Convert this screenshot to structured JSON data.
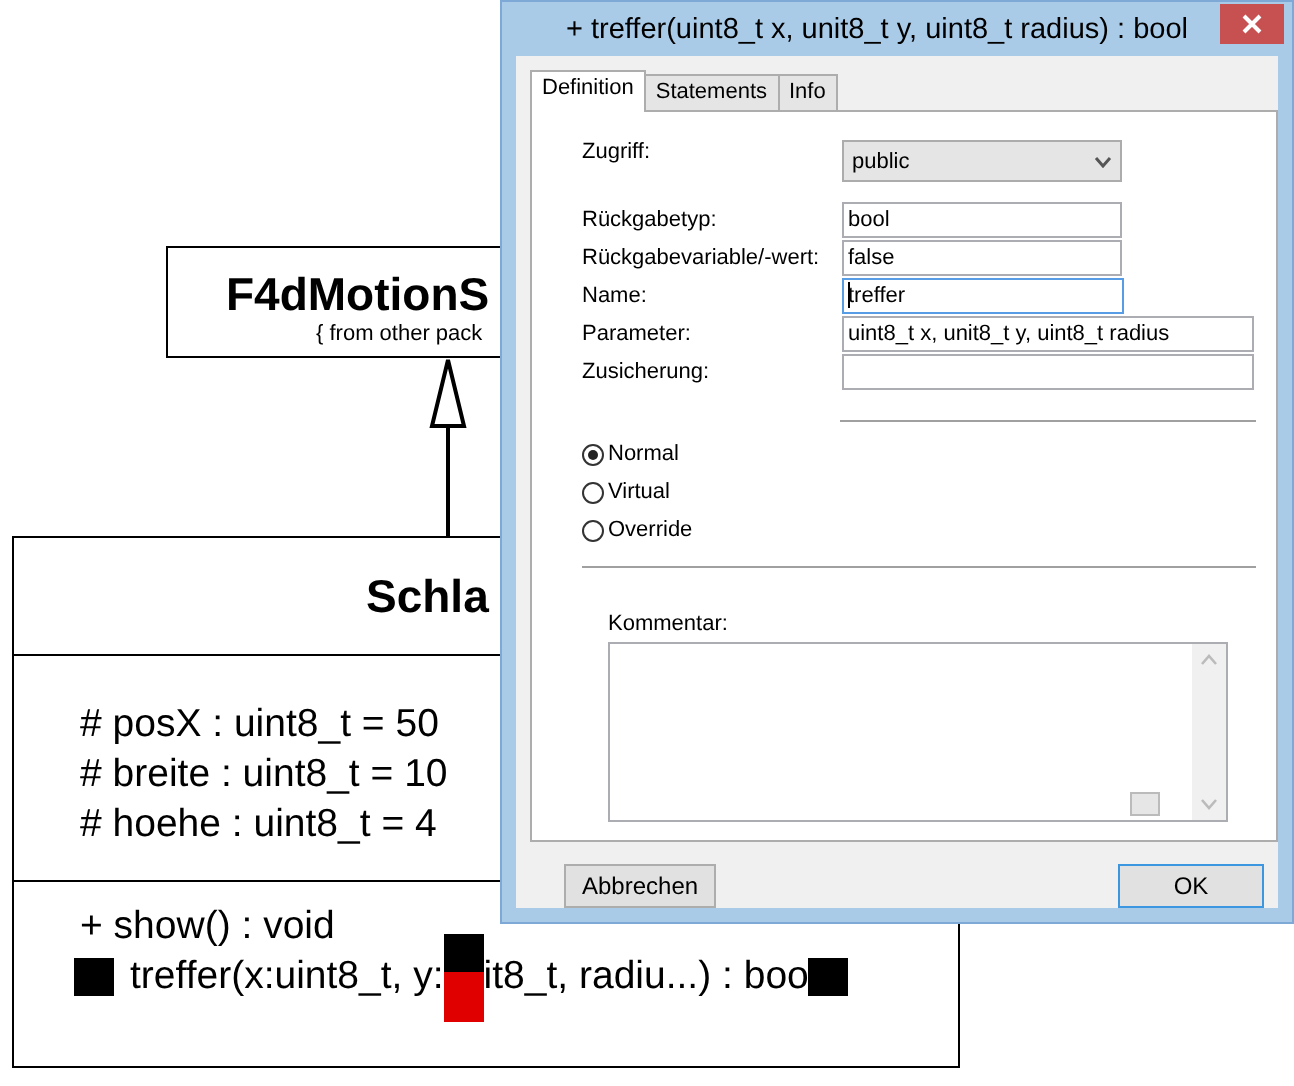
{
  "diagram": {
    "base_class": {
      "name": "F4dMotionS",
      "note": "{ from other pack"
    },
    "class": {
      "name": "Schla",
      "attributes": [
        "# posX : uint8_t = 50",
        "# breite : uint8_t = 10",
        "# hoehe : uint8_t = 4"
      ],
      "methods": [
        {
          "parts": [
            "+ show() : void"
          ],
          "selected": false
        },
        {
          "parts": [
            "treffer(x:uint8_t, y:",
            "it8_t, radiu...) : boo"
          ],
          "selected": true
        }
      ]
    }
  },
  "dialog": {
    "title": "+ treffer(uint8_t x, unit8_t y, uint8_t radius) : bool",
    "tabs": [
      {
        "label": "Definition",
        "selected": true
      },
      {
        "label": "Statements",
        "selected": false
      },
      {
        "label": "Info",
        "selected": false
      }
    ],
    "fields": [
      {
        "kind": "select",
        "label": "Zugriff:",
        "value": "public"
      },
      {
        "kind": "text",
        "label": "Rückgabetyp:",
        "value": "bool"
      },
      {
        "kind": "text",
        "label": "Rückgabevariable/-wert:",
        "value": "false"
      },
      {
        "kind": "text",
        "label": "Name:",
        "value": "treffer",
        "focused": true
      },
      {
        "kind": "text",
        "label": "Parameter:",
        "value": "uint8_t x, unit8_t y, uint8_t radius"
      },
      {
        "kind": "text",
        "label": "Zusicherung:"
      }
    ],
    "options": [
      {
        "label": "Normal",
        "selected": true
      },
      {
        "label": "Virtual",
        "selected": false
      },
      {
        "label": "Override",
        "selected": false
      }
    ],
    "comment": {
      "label": "Kommentar:"
    },
    "buttons": [
      {
        "label": "Abbrechen",
        "default": false
      },
      {
        "label": "OK",
        "default": true
      }
    ]
  }
}
